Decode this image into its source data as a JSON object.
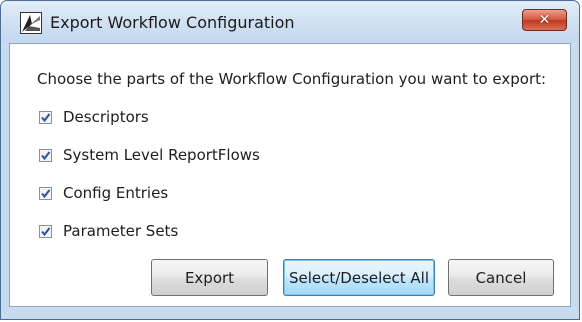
{
  "window": {
    "title": "Export Workflow Configuration",
    "app_icon": "workflow-app-icon",
    "close_icon": "close-icon",
    "close_color": "#c7402a"
  },
  "content": {
    "prompt": "Choose the parts of the Workflow Configuration you want to export:",
    "options": [
      {
        "label": "Descriptors",
        "checked": true
      },
      {
        "label": "System Level ReportFlows",
        "checked": true
      },
      {
        "label": "Config Entries",
        "checked": true
      },
      {
        "label": "Parameter Sets",
        "checked": true
      }
    ]
  },
  "buttons": {
    "export": "Export",
    "select_all": "Select/Deselect All",
    "cancel": "Cancel"
  }
}
